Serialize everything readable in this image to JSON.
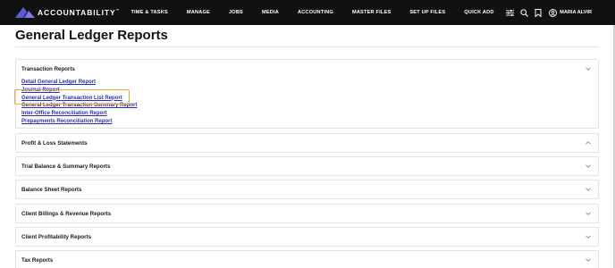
{
  "brand": {
    "name": "ACCOUNTABILITY",
    "trademark": "™",
    "logo_color": "#5b5bd6"
  },
  "nav": {
    "items": [
      {
        "label": "TIME & TASKS"
      },
      {
        "label": "MANAGE"
      },
      {
        "label": "JOBS"
      },
      {
        "label": "MEDIA"
      },
      {
        "label": "ACCOUNTING"
      },
      {
        "label": "MASTER FILES"
      },
      {
        "label": "SET UP FILES"
      },
      {
        "label": "QUICK ADD"
      }
    ],
    "icons": [
      "sliders-icon",
      "search-icon",
      "bookmark-icon",
      "user-icon"
    ],
    "user_name": "MARIA ALVIR"
  },
  "page": {
    "title": "General Ledger Reports"
  },
  "sections": [
    {
      "title": "Transaction Reports",
      "expanded": true,
      "links": [
        {
          "label": "Detail General Ledger Report"
        },
        {
          "label": "Journal Report"
        },
        {
          "label": "General Ledger Transaction List Report",
          "highlighted": true
        },
        {
          "label": "General Ledger Transaction Summary Report"
        },
        {
          "label": "Inter-Office Reconciliation Report"
        },
        {
          "label": "Prepayments Reconciliation Report"
        }
      ]
    },
    {
      "title": "Profit & Loss Statements",
      "expanded": false,
      "chevron": "up"
    },
    {
      "title": "Trial Balance & Summary Reports",
      "expanded": false,
      "chevron": "down"
    },
    {
      "title": "Balance Sheet Reports",
      "expanded": false,
      "chevron": "down"
    },
    {
      "title": "Client Billings & Revenue Reports",
      "expanded": false,
      "chevron": "down"
    },
    {
      "title": "Client Profitability Reports",
      "expanded": false,
      "chevron": "down"
    },
    {
      "title": "Tax Reports",
      "expanded": false,
      "chevron": "down"
    }
  ],
  "colors": {
    "link": "#2b2fb8",
    "highlight": "#f0a830",
    "topbar": "#111111"
  }
}
